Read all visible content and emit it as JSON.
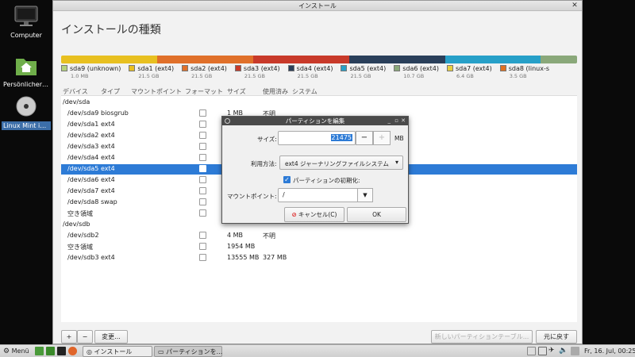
{
  "desktop": {
    "icons": [
      {
        "label": "Computer"
      },
      {
        "label": "Persönlicher ..."
      },
      {
        "label": "Linux Mint in..."
      }
    ]
  },
  "window": {
    "title": "インストール",
    "close_glyph": "✕",
    "heading": "インストールの種類"
  },
  "partitions": [
    {
      "name": "sda9 (unknown)",
      "size": "1.0 MB",
      "color": "#b5d27c"
    },
    {
      "name": "sda1 (ext4)",
      "size": "21.5 GB",
      "color": "#e8c020"
    },
    {
      "name": "sda2 (ext4)",
      "size": "21.5 GB",
      "color": "#e0702a"
    },
    {
      "name": "sda3 (ext4)",
      "size": "21.5 GB",
      "color": "#c83a2a"
    },
    {
      "name": "sda4 (ext4)",
      "size": "21.5 GB",
      "color": "#2a3f5a"
    },
    {
      "name": "sda5 (ext4)",
      "size": "21.5 GB",
      "color": "#27a0c8"
    },
    {
      "name": "sda6 (ext4)",
      "size": "10.7 GB",
      "color": "#8aa87a"
    },
    {
      "name": "sda7 (ext4)",
      "size": "6.4 GB",
      "color": "#e8d040"
    },
    {
      "name": "sda8 (linux-s",
      "size": "3.5 GB",
      "color": "#e07020"
    }
  ],
  "partition_bar": [
    {
      "color": "#e8c020",
      "share": 0.186
    },
    {
      "color": "#e0702a",
      "share": 0.186
    },
    {
      "color": "#c83a2a",
      "share": 0.186
    },
    {
      "color": "#2a3f5a",
      "share": 0.186
    },
    {
      "color": "#27a0c8",
      "share": 0.186
    },
    {
      "color": "#8aa87a",
      "share": 0.07
    }
  ],
  "table": {
    "columns": {
      "device": "デバイス",
      "type": "タイプ",
      "mount": "マウントポイント",
      "format": "フォーマット",
      "size": "サイズ",
      "used": "使用済み",
      "system": "システム"
    },
    "rows": [
      {
        "device": "/dev/sda",
        "type": "",
        "size": "",
        "used": "",
        "checkbox": false,
        "group": true
      },
      {
        "device": "/dev/sda9",
        "type": "biosgrub",
        "size": "1 MB",
        "used": "不明",
        "checkbox": true
      },
      {
        "device": "/dev/sda1",
        "type": "ext4",
        "size": "",
        "used": "",
        "checkbox": true
      },
      {
        "device": "/dev/sda2",
        "type": "ext4",
        "size": "",
        "used": "",
        "checkbox": true
      },
      {
        "device": "/dev/sda3",
        "type": "ext4",
        "size": "",
        "used": "",
        "checkbox": true
      },
      {
        "device": "/dev/sda4",
        "type": "ext4",
        "size": "",
        "used": "",
        "checkbox": true
      },
      {
        "device": "/dev/sda5",
        "type": "ext4",
        "size": "",
        "used": "",
        "checkbox": true,
        "selected": true
      },
      {
        "device": "/dev/sda6",
        "type": "ext4",
        "size": "",
        "used": "",
        "checkbox": true
      },
      {
        "device": "/dev/sda7",
        "type": "ext4",
        "size": "",
        "used": "",
        "checkbox": true
      },
      {
        "device": "/dev/sda8",
        "type": "swap",
        "size": "",
        "used": "",
        "checkbox": true
      },
      {
        "device": "空き領域",
        "type": "",
        "size": "",
        "used": "",
        "checkbox": true
      },
      {
        "device": "/dev/sdb",
        "type": "",
        "size": "",
        "used": "",
        "checkbox": false,
        "group": true
      },
      {
        "device": "/dev/sdb2",
        "type": "",
        "size": "4 MB",
        "used": "不明",
        "checkbox": true
      },
      {
        "device": "空き領域",
        "type": "",
        "size": "1954 MB",
        "used": "",
        "checkbox": true
      },
      {
        "device": "/dev/sdb3",
        "type": "ext4",
        "size": "13555 MB",
        "used": "327 MB",
        "checkbox": true
      }
    ]
  },
  "bottom": {
    "add": "+",
    "remove": "−",
    "change": "変更...",
    "new_table": "新しいパーティションテーブル...",
    "revert": "元に戻す"
  },
  "dialog": {
    "title": "パーティションを編集",
    "ctl_min": "_",
    "ctl_max": "▫",
    "ctl_close": "✕",
    "size_label": "サイズ:",
    "size_value": "21475",
    "size_unit": "MB",
    "minus": "−",
    "plus": "+",
    "use_label": "利用方法:",
    "use_value": "ext4 ジャーナリングファイルシステム",
    "format_label": "パーティションの初期化:",
    "mount_label": "マウントポイント:",
    "mount_value": "/",
    "cancel": "キャンセル(C)",
    "ok": "OK"
  },
  "taskbar": {
    "menu": "Menü",
    "tasks": [
      "インストール",
      "パーティションを..."
    ],
    "clock": "Fr, 16. Jul, 00:25"
  }
}
